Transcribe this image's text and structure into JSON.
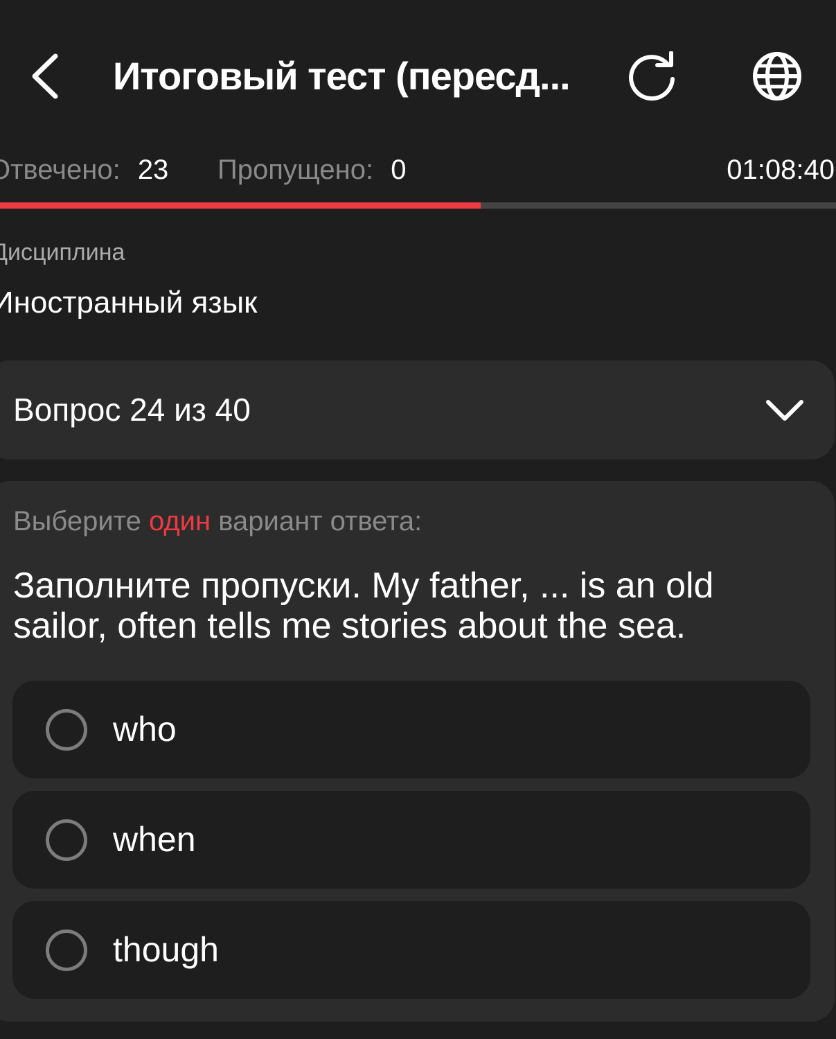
{
  "header": {
    "title": "Итоговый тест (пересд...",
    "back_icon": "chevron-left-icon",
    "refresh_icon": "refresh-icon",
    "language_icon": "globe-icon"
  },
  "stats": {
    "answered_label": "Отвечено:",
    "answered_value": "23",
    "skipped_label": "Пропущено:",
    "skipped_value": "0",
    "timer": "01:08:40"
  },
  "progress": {
    "fraction": 0.575,
    "fill_color": "#ee3a43",
    "track_color": "#454545"
  },
  "discipline": {
    "label": "Дисциплина",
    "value": "Иностранный язык"
  },
  "question_selector": {
    "label": "Вопрос 24 из 40",
    "icon": "chevron-down-icon"
  },
  "question": {
    "instruction_prefix": "Выберите",
    "instruction_accent": "один",
    "instruction_suffix": "вариант ответа:",
    "text": "Заполните пропуски. My father, ... is an old sailor, often tells me stories about the sea.",
    "options": [
      {
        "label": "who",
        "selected": false
      },
      {
        "label": "when",
        "selected": false
      },
      {
        "label": "though",
        "selected": false
      }
    ]
  },
  "colors": {
    "background": "#1e1e1e",
    "card": "#2c2c2c",
    "accent": "#ee3a43",
    "muted_text": "#8a8a8a"
  }
}
